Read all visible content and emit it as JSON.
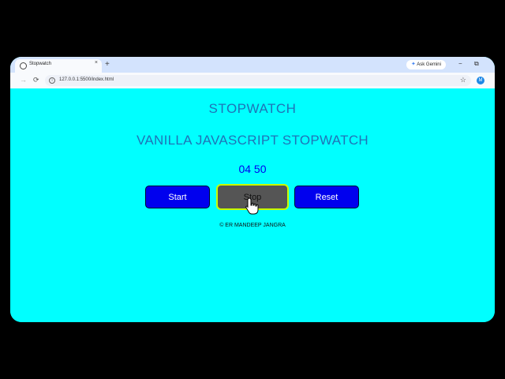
{
  "browser": {
    "tab_title": "Stopwatch",
    "tab_close": "×",
    "new_tab": "+",
    "ask_gemini": "Ask Gemini",
    "url": "127.0.0.1:5500/index.html",
    "profile_initial": "M",
    "minimize": "−",
    "restore": "⧉"
  },
  "page": {
    "title": "STOPWATCH",
    "subtitle": "VANILLA JAVASCRIPT STOPWATCH",
    "time_display": "04 50",
    "buttons": {
      "start": "Start",
      "stop": "Stop",
      "reset": "Reset"
    },
    "footer": "© ER MANDEEP JANGRA"
  },
  "colors": {
    "page_background": "#00ffff",
    "title": "#1f73b7",
    "timer": "#0000ee",
    "button_primary": "#0000ee",
    "button_active": "#555555",
    "button_active_border": "#c9ff00"
  },
  "icons": {
    "favicon": "globe-icon",
    "back": "arrow-left-icon",
    "reload": "reload-icon",
    "site_info": "info-icon",
    "bookmark": "star-icon",
    "cursor": "hand-pointer-icon"
  }
}
